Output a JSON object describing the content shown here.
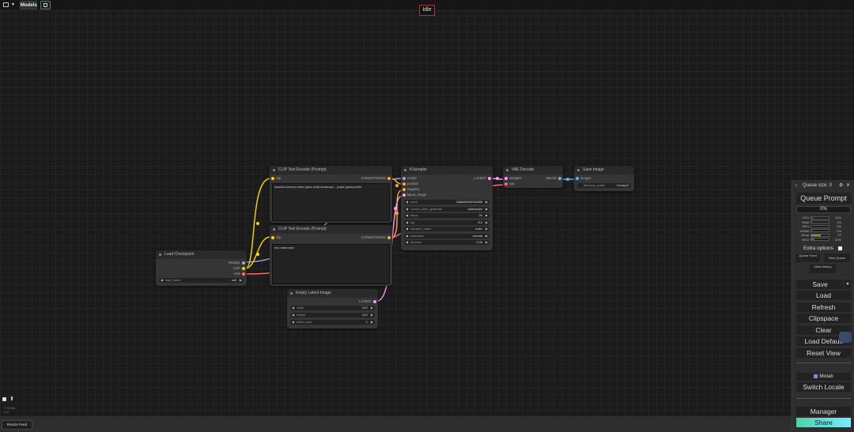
{
  "topbar": {
    "workflow_icon": "workflow-menu-icon",
    "models_label": "Models",
    "save_icon": "floppy-icon"
  },
  "status": {
    "idle": "Idle"
  },
  "nodes": {
    "clip_pos": {
      "title": "CLIP Text Encode (Prompt)",
      "in_clip": "clip",
      "out": "CONDITIONING",
      "text": "beautiful scenery nature glass bottle landscape, , purple galaxy bottle,"
    },
    "clip_neg": {
      "title": "CLIP Text Encode (Prompt)",
      "in_clip": "clip",
      "out": "CONDITIONING",
      "text": "text, watermark"
    },
    "ksampler": {
      "title": "KSampler",
      "inputs": [
        "model",
        "positive",
        "negative",
        "latent_image"
      ],
      "out": "LATENT",
      "widgets": [
        {
          "label": "seed",
          "value": "156680208700285"
        },
        {
          "label": "control_after_generate",
          "value": "randomize"
        },
        {
          "label": "steps",
          "value": "20"
        },
        {
          "label": "cfg",
          "value": "8.0"
        },
        {
          "label": "sampler_name",
          "value": "euler"
        },
        {
          "label": "scheduler",
          "value": "normal"
        },
        {
          "label": "denoise",
          "value": "1.00"
        }
      ]
    },
    "vae_decode": {
      "title": "VAE Decode",
      "in_samples": "samples",
      "in_vae": "vae",
      "out": "IMAGE"
    },
    "save_image": {
      "title": "Save Image",
      "in_images": "images",
      "widget_label": "filename_prefix",
      "widget_value": "ComfyUI"
    },
    "load_checkpoint": {
      "title": "Load Checkpoint",
      "outputs": [
        "MODEL",
        "CLIP",
        "VAE"
      ],
      "widget_label": "ckpt_name",
      "widget_value": "null"
    },
    "empty_latent": {
      "title": "Empty Latent Image",
      "out": "LATENT",
      "widgets": [
        {
          "label": "width",
          "value": "512"
        },
        {
          "label": "height",
          "value": "512"
        },
        {
          "label": "batch_size",
          "value": "1"
        }
      ]
    }
  },
  "colors": {
    "clip": "#ffd500",
    "model": "#b39ddb",
    "vae": "#ff6e6e",
    "conditioning": "#ffa931",
    "latent": "#ff9cf9",
    "image": "#64b5f6"
  },
  "panel": {
    "queue_size": "Queue size: 0",
    "queue_prompt": "Queue Prompt",
    "progress": "0%",
    "monitor": [
      {
        "label": "CPU",
        "value": "11%",
        "fill": 0.11,
        "color": "#1a7f1a"
      },
      {
        "label": "RAM",
        "value": "1%",
        "fill": 0.01,
        "color": "#1a7f1a"
      },
      {
        "label": "GPU",
        "value": "0%",
        "fill": 0.0,
        "color": "#1a7f1a"
      },
      {
        "label": "VRAM",
        "value": "2%",
        "fill": 0.02,
        "color": "#1a7f1a"
      },
      {
        "label": "Temp",
        "value": "27",
        "fill": 0.55,
        "color": "#5fae1a"
      },
      {
        "label": "HDD",
        "value": "20%",
        "fill": 0.2,
        "color": "#7b3fa0"
      }
    ],
    "extra_options": "Extra options",
    "queue_front": "Queue Front",
    "view_queue": "View Queue",
    "view_history": "View History",
    "save": "Save",
    "load": "Load",
    "refresh": "Refresh",
    "clipspace": "Clipspace",
    "clear": "Clear",
    "load_default": "Load Default",
    "reset_view": "Reset View",
    "mixlab": "Mixlab",
    "switch_locale": "Switch Locale",
    "manager": "Manager",
    "share": "Share"
  },
  "footer": {
    "status_t": "T: 0.00s",
    "status_i": "I: 0",
    "resize_feed": "Resize Feed"
  }
}
